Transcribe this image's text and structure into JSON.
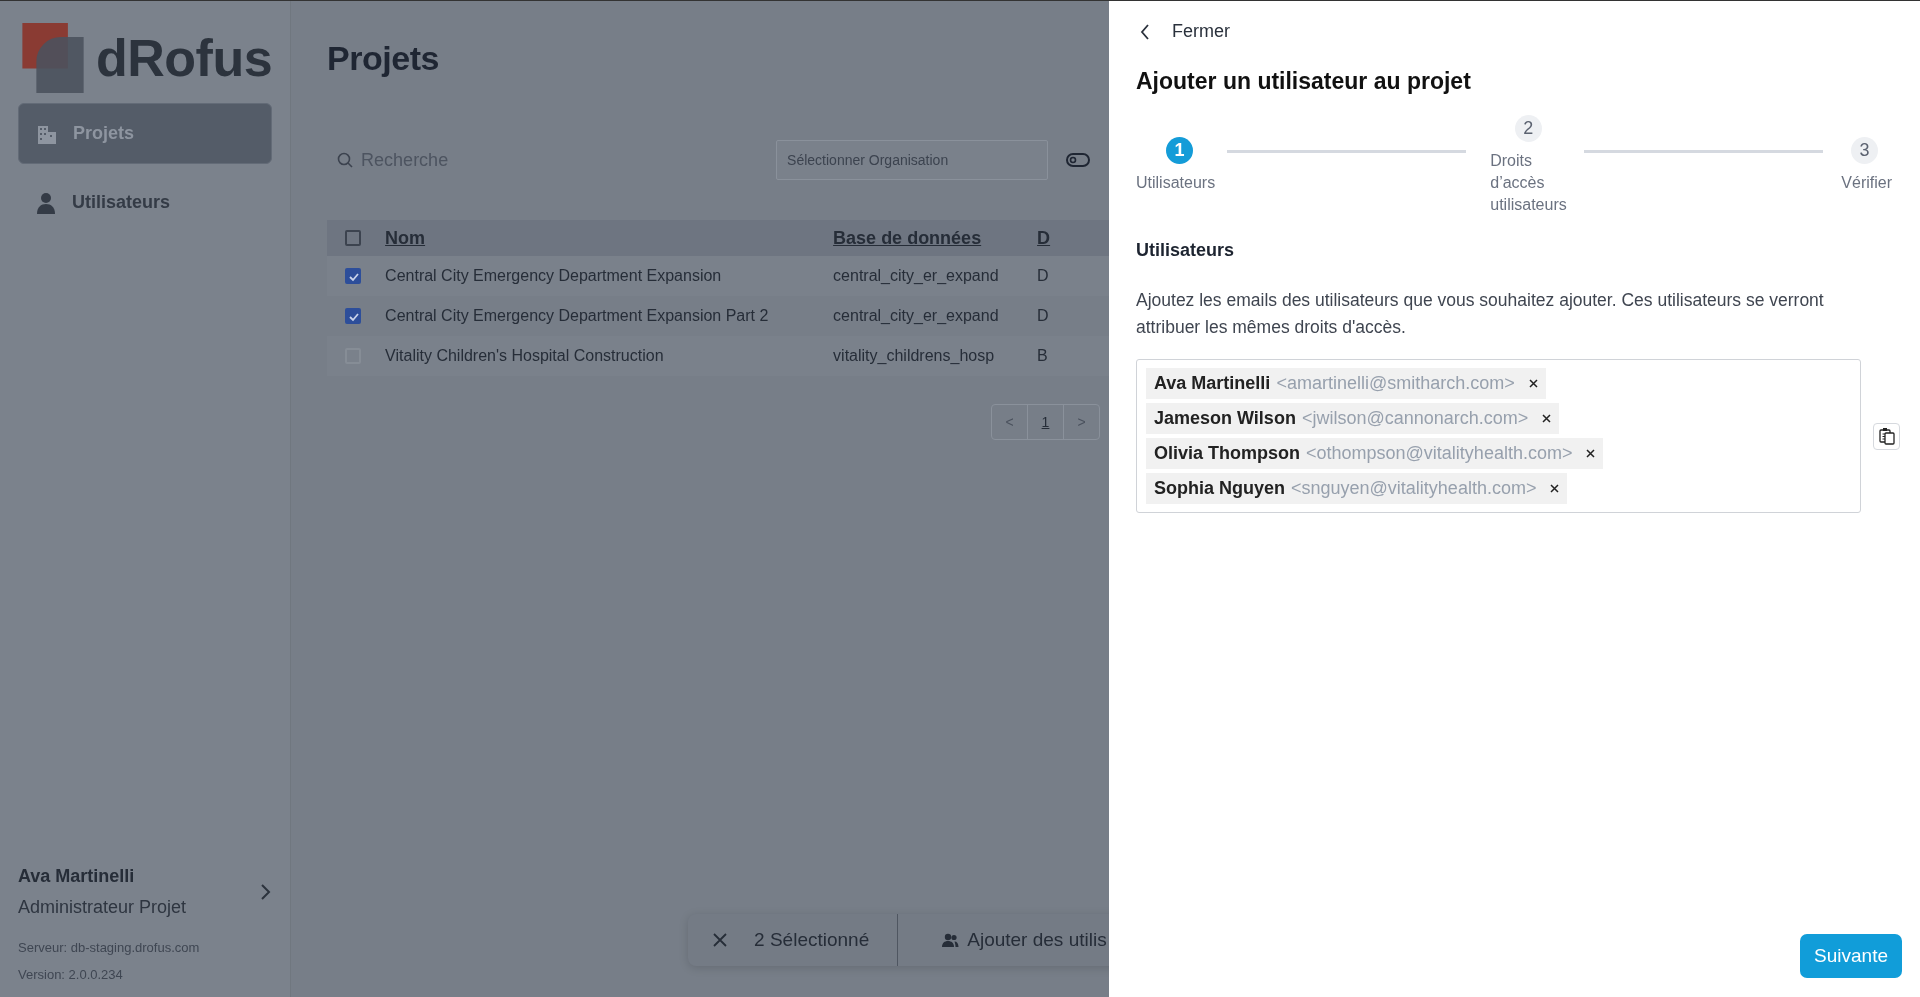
{
  "logo": {
    "text": "dRofus"
  },
  "sidebar": {
    "items": [
      {
        "label": "Projets",
        "selected": true
      },
      {
        "label": "Utilisateurs",
        "selected": false
      }
    ],
    "user": {
      "name": "Ava Martinelli",
      "role": "Administrateur Projet"
    },
    "server": "Serveur: db-staging.drofus.com",
    "version": "Version: 2.0.0.234"
  },
  "main": {
    "title": "Projets",
    "search": {
      "placeholder": "Recherche"
    },
    "organisation_select": {
      "placeholder": "Sélectionner Organisation"
    },
    "table": {
      "columns": [
        "Nom",
        "Base de données",
        "D"
      ],
      "header_checked": false,
      "rows": [
        {
          "checked": true,
          "cells": [
            "Central City Emergency Department Expansion",
            "central_city_er_expand",
            "D"
          ]
        },
        {
          "checked": true,
          "cells": [
            "Central City Emergency Department Expansion Part 2",
            "central_city_er_expand",
            "D"
          ]
        },
        {
          "checked": false,
          "cells": [
            "Vitality Children's Hospital Construction",
            "vitality_childrens_hosp",
            "B"
          ]
        }
      ]
    },
    "pagination": {
      "prev": "<",
      "pages": [
        {
          "label": "1",
          "selected": true
        }
      ],
      "next": ">"
    },
    "selection_bar": {
      "count": "2 Sélectionné",
      "action": "Ajouter des utilis"
    }
  },
  "drawer": {
    "back": "Fermer",
    "title": "Ajouter un utilisateur au projet",
    "steps": [
      {
        "number": "1",
        "label": "Utilisateurs",
        "active": true
      },
      {
        "number": "2",
        "label": "Droits d’accès utilisateurs",
        "active": false
      },
      {
        "number": "3",
        "label": "Vérifier",
        "active": false
      }
    ],
    "section_title": "Utilisateurs",
    "description": "Ajoutez les emails des utilisateurs que vous souhaitez ajouter. Ces utilisateurs se verront attribuer les mêmes droits d'accès.",
    "users": [
      {
        "name": "Ava Martinelli",
        "email": "<amartinelli@smitharch.com>"
      },
      {
        "name": "Jameson Wilson",
        "email": "<jwilson@cannonarch.com>"
      },
      {
        "name": "Olivia Thompson",
        "email": "<othompson@vitalityhealth.com>"
      },
      {
        "name": "Sophia Nguyen",
        "email": "<snguyen@vitalityhealth.com>"
      }
    ],
    "next_button": "Suivante"
  }
}
